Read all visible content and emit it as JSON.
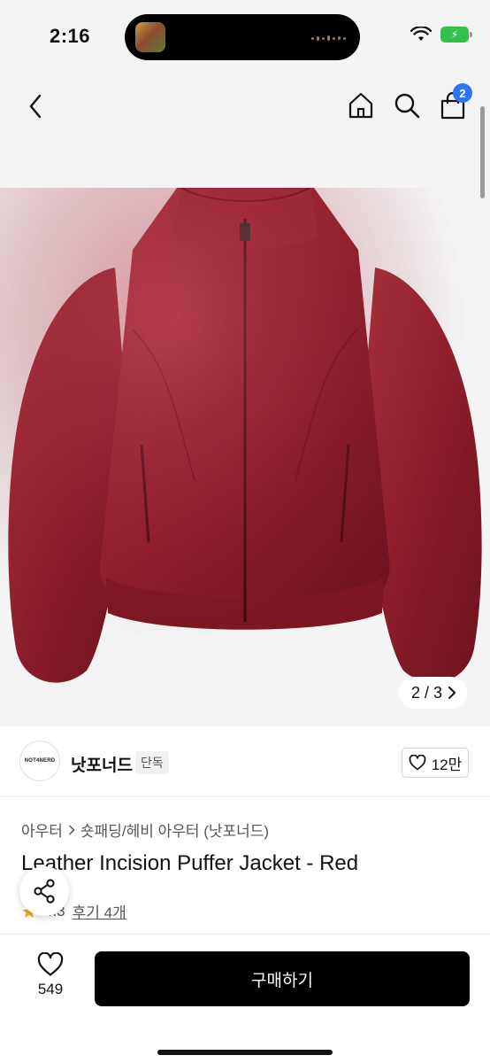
{
  "status_bar": {
    "time": "2:16"
  },
  "nav": {
    "cart_count": "2"
  },
  "gallery": {
    "counter": "2 / 3",
    "image_alt": "Leather Incision Puffer Jacket - Red"
  },
  "brand": {
    "logo_text": "NOT4NERD",
    "name": "낫포너드",
    "tag": "단독",
    "likes": "12만"
  },
  "breadcrumb": {
    "items": [
      "아우터",
      "숏패딩/헤비 아우터 (낫포너드)"
    ]
  },
  "product": {
    "title": "Leather Incision Puffer Jacket - Red",
    "rating": "4.3",
    "reviews": "후기 4개"
  },
  "bottom_bar": {
    "wish_count": "549",
    "buy_label": "구매하기"
  },
  "colors": {
    "accent_badge": "#2f74f5",
    "buy_button": "#000000",
    "jacket": "#8f1f2b",
    "star": "#f5a623"
  },
  "icons": [
    "back-icon",
    "home-icon",
    "search-icon",
    "cart-icon",
    "heart-icon",
    "share-icon",
    "chevron-right-icon",
    "star-icon"
  ]
}
